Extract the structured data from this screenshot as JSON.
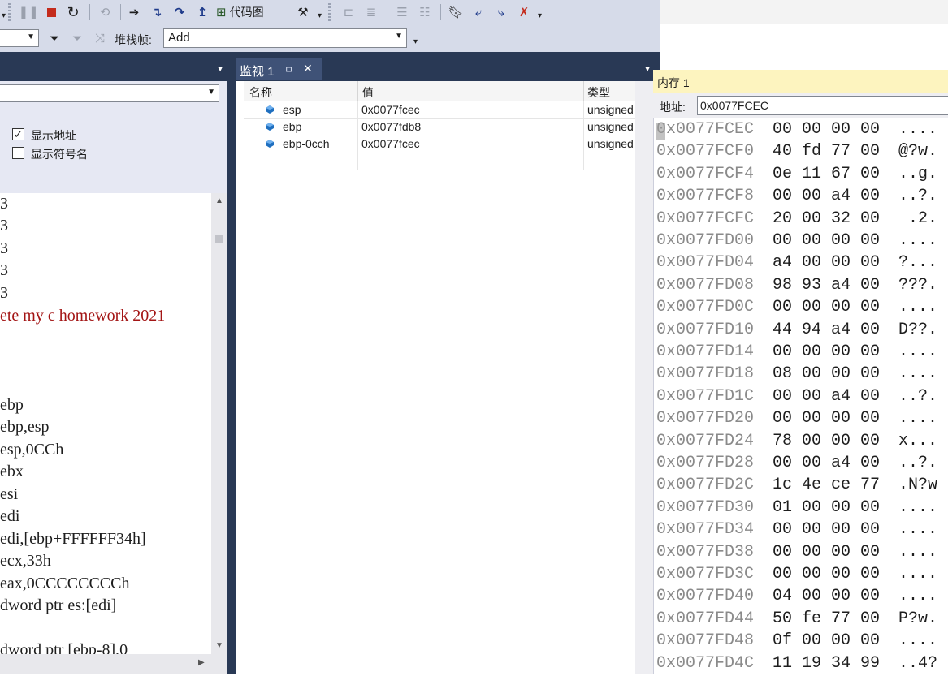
{
  "toolbar1": {
    "code_map_label": "代码图"
  },
  "toolbar2": {
    "stack_frame_label": "堆栈帧:",
    "stack_frame_value": "Add"
  },
  "disasm": {
    "options": {
      "show_address": "显示地址",
      "show_address_checked": true,
      "show_symbol": "显示符号名",
      "show_symbol_checked": false
    },
    "lines": [
      "3",
      "3",
      "3",
      "3",
      "3",
      "ete my c homework 2021",
      "",
      "",
      "",
      "ebp",
      "ebp,esp",
      "esp,0CCh",
      "ebx",
      "esi",
      "edi",
      "edi,[ebp+FFFFFF34h]",
      "ecx,33h",
      "eax,0CCCCCCCCh",
      "dword ptr es:[edi]",
      "",
      "dword ptr [ebp-8],0"
    ]
  },
  "watch": {
    "tab_label": "监视 1",
    "pin_glyph": "ㅁ",
    "close_glyph": "✕",
    "columns": [
      "名称",
      "值",
      "类型"
    ],
    "rows": [
      {
        "name": "esp",
        "value": "0x0077fcec",
        "type": "unsigned"
      },
      {
        "name": "ebp",
        "value": "0x0077fdb8",
        "type": "unsigned"
      },
      {
        "name": "ebp-0cch",
        "value": "0x0077fcec",
        "type": "unsigned"
      }
    ]
  },
  "memory": {
    "title": "内存 1",
    "address_label": "地址:",
    "address_value": "0x0077FCEC",
    "rows": [
      {
        "addr": "0x0077FCEC",
        "bytes": "00 00 00 00",
        "ascii": "...."
      },
      {
        "addr": "0x0077FCF0",
        "bytes": "40 fd 77 00",
        "ascii": "@?w."
      },
      {
        "addr": "0x0077FCF4",
        "bytes": "0e 11 67 00",
        "ascii": "..g."
      },
      {
        "addr": "0x0077FCF8",
        "bytes": "00 00 a4 00",
        "ascii": "..?."
      },
      {
        "addr": "0x0077FCFC",
        "bytes": "20 00 32 00",
        "ascii": " .2."
      },
      {
        "addr": "0x0077FD00",
        "bytes": "00 00 00 00",
        "ascii": "...."
      },
      {
        "addr": "0x0077FD04",
        "bytes": "a4 00 00 00",
        "ascii": "?..."
      },
      {
        "addr": "0x0077FD08",
        "bytes": "98 93 a4 00",
        "ascii": "???."
      },
      {
        "addr": "0x0077FD0C",
        "bytes": "00 00 00 00",
        "ascii": "...."
      },
      {
        "addr": "0x0077FD10",
        "bytes": "44 94 a4 00",
        "ascii": "D??."
      },
      {
        "addr": "0x0077FD14",
        "bytes": "00 00 00 00",
        "ascii": "...."
      },
      {
        "addr": "0x0077FD18",
        "bytes": "08 00 00 00",
        "ascii": "...."
      },
      {
        "addr": "0x0077FD1C",
        "bytes": "00 00 a4 00",
        "ascii": "..?."
      },
      {
        "addr": "0x0077FD20",
        "bytes": "00 00 00 00",
        "ascii": "...."
      },
      {
        "addr": "0x0077FD24",
        "bytes": "78 00 00 00",
        "ascii": "x..."
      },
      {
        "addr": "0x0077FD28",
        "bytes": "00 00 a4 00",
        "ascii": "..?."
      },
      {
        "addr": "0x0077FD2C",
        "bytes": "1c 4e ce 77",
        "ascii": ".N?w"
      },
      {
        "addr": "0x0077FD30",
        "bytes": "01 00 00 00",
        "ascii": "...."
      },
      {
        "addr": "0x0077FD34",
        "bytes": "00 00 00 00",
        "ascii": "...."
      },
      {
        "addr": "0x0077FD38",
        "bytes": "00 00 00 00",
        "ascii": "...."
      },
      {
        "addr": "0x0077FD3C",
        "bytes": "00 00 00 00",
        "ascii": "...."
      },
      {
        "addr": "0x0077FD40",
        "bytes": "04 00 00 00",
        "ascii": "...."
      },
      {
        "addr": "0x0077FD44",
        "bytes": "50 fe 77 00",
        "ascii": "P?w."
      },
      {
        "addr": "0x0077FD48",
        "bytes": "0f 00 00 00",
        "ascii": "...."
      },
      {
        "addr": "0x0077FD4C",
        "bytes": "11 19 34 99",
        "ascii": "..4?"
      }
    ]
  },
  "colors": {
    "toolbar_bg": "#d6dbe9",
    "dark_header": "#293955",
    "tab_active": "#3f5277",
    "memory_title_bg": "#fdf4bf",
    "code_string": "#a31515"
  }
}
